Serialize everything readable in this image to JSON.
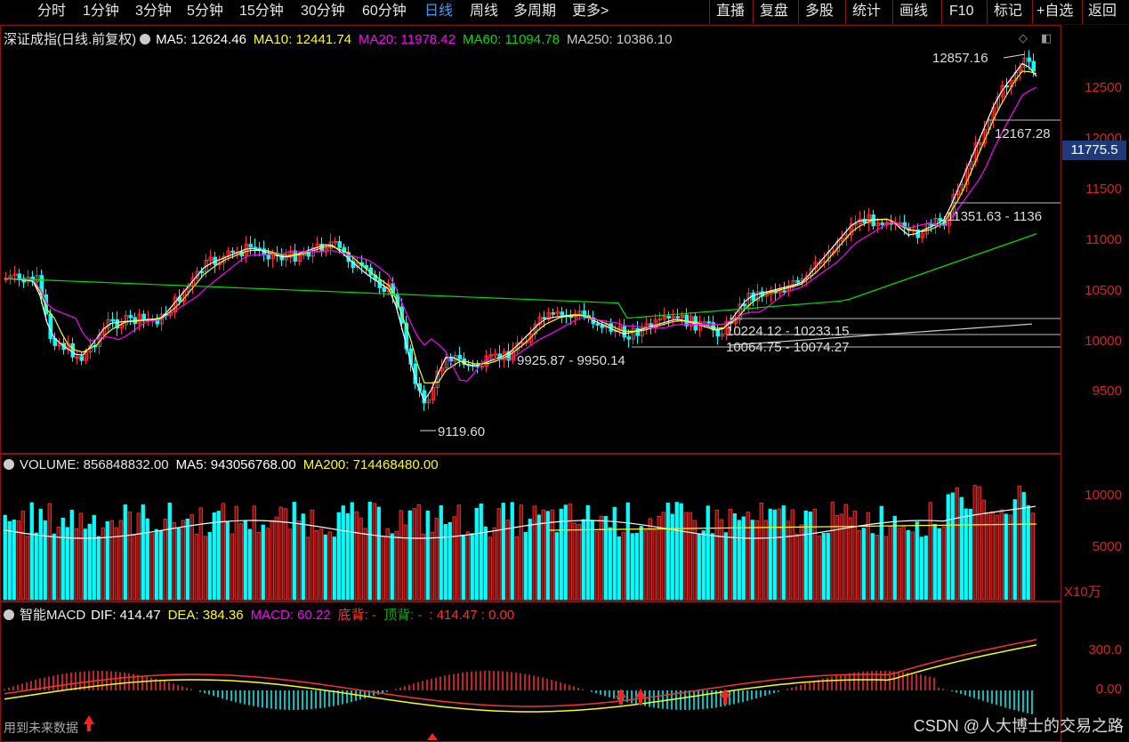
{
  "toolbar": {
    "periods": [
      "分时",
      "1分钟",
      "3分钟",
      "5分钟",
      "15分钟",
      "30分钟",
      "60分钟",
      "日线",
      "周线",
      "多周期",
      "更多>"
    ],
    "active_period": "日线",
    "actions": [
      "直播",
      "复盘",
      "多股",
      "统计",
      "画线",
      "F10",
      "标记",
      "+自选",
      "返回"
    ]
  },
  "main_legend": {
    "title": "深证成指(日线.前复权)",
    "ma5": "MA5: 12624.46",
    "ma10": "MA10: 12441.74",
    "ma20": "MA20: 11978.42",
    "ma60": "MA60: 11094.78",
    "ma250": "MA250: 10386.10"
  },
  "colors": {
    "ma5": "#ffffff",
    "ma10": "#ffff00",
    "ma20": "#ff00ff",
    "ma60": "#00dd00",
    "ma250": "#cccccc",
    "up": "#ff3030",
    "down": "#00ffff",
    "axis": "#ff2a2a",
    "border": "#8a1212",
    "active": "#33a0ff"
  },
  "price_axis": [
    "12500",
    "12000",
    "11500",
    "11000",
    "10500",
    "10000",
    "9500"
  ],
  "current_price_tag": "11775.5",
  "annotations": {
    "high": "12857.16",
    "low": "9119.60",
    "range1": "9925.87 - 9950.14",
    "range2": "10224.12 - 10233.15",
    "range3": "10064.75 - 10074.27",
    "range4": "11351.63 - 1136",
    "range5": "12167.28"
  },
  "volume_legend": {
    "title": "VOLUME: 856848832.00",
    "ma5": "MA5: 943056768.00",
    "ma200": "MA200: 714468480.00"
  },
  "volume_axis": [
    "10000",
    "5000"
  ],
  "volume_unit": "X10万",
  "macd_legend": {
    "title": "智能MACD",
    "dif": "DIF: 414.47",
    "dea": "DEA: 384.36",
    "macd": "MACD: 60.22",
    "bottom_div": "底背: -",
    "top_div": "顶背: -",
    "extra": ": 414.47 : 0.00"
  },
  "macd_axis": [
    "300.0",
    "0.00"
  ],
  "hint_text": "用到未来数据",
  "watermark": "CSDN @人大博士的交易之路"
}
